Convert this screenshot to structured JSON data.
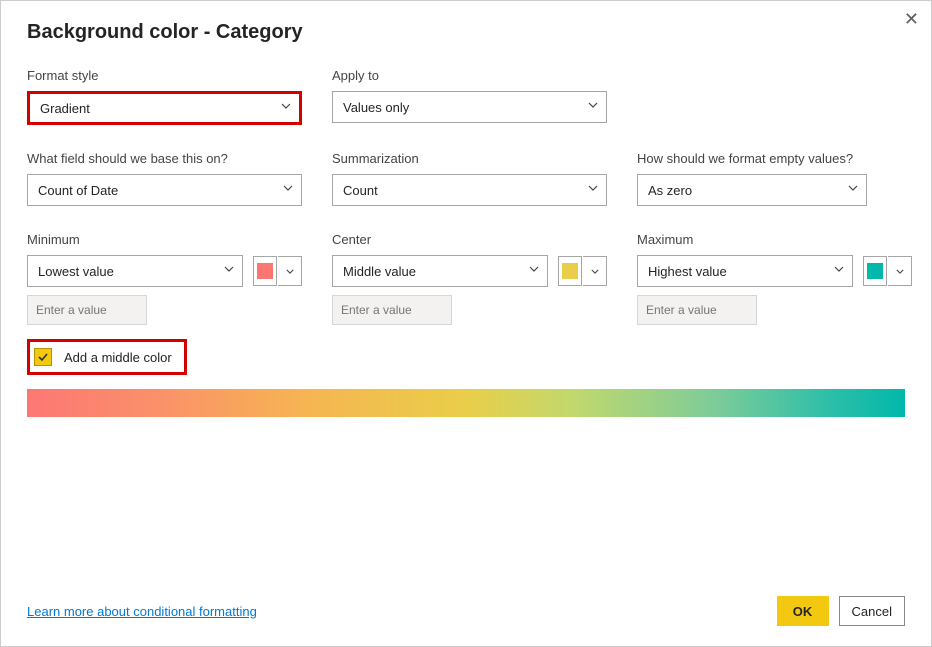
{
  "title": "Background color - Category",
  "labels": {
    "format_style": "Format style",
    "apply_to": "Apply to",
    "field_base": "What field should we base this on?",
    "summarization": "Summarization",
    "empty_values": "How should we format empty values?",
    "minimum": "Minimum",
    "center": "Center",
    "maximum": "Maximum"
  },
  "selects": {
    "format_style": "Gradient",
    "apply_to": "Values only",
    "field_base": "Count of Date",
    "summarization": "Count",
    "empty_values": "As zero",
    "minimum": "Lowest value",
    "center": "Middle value",
    "maximum": "Highest value"
  },
  "placeholders": {
    "enter_value": "Enter a value"
  },
  "colors": {
    "min": "#fc7774",
    "center": "#e9ce49",
    "max": "#01b8aa"
  },
  "checkbox": {
    "middle_color": "Add a middle color"
  },
  "link": "Learn more about conditional formatting",
  "buttons": {
    "ok": "OK",
    "cancel": "Cancel"
  }
}
